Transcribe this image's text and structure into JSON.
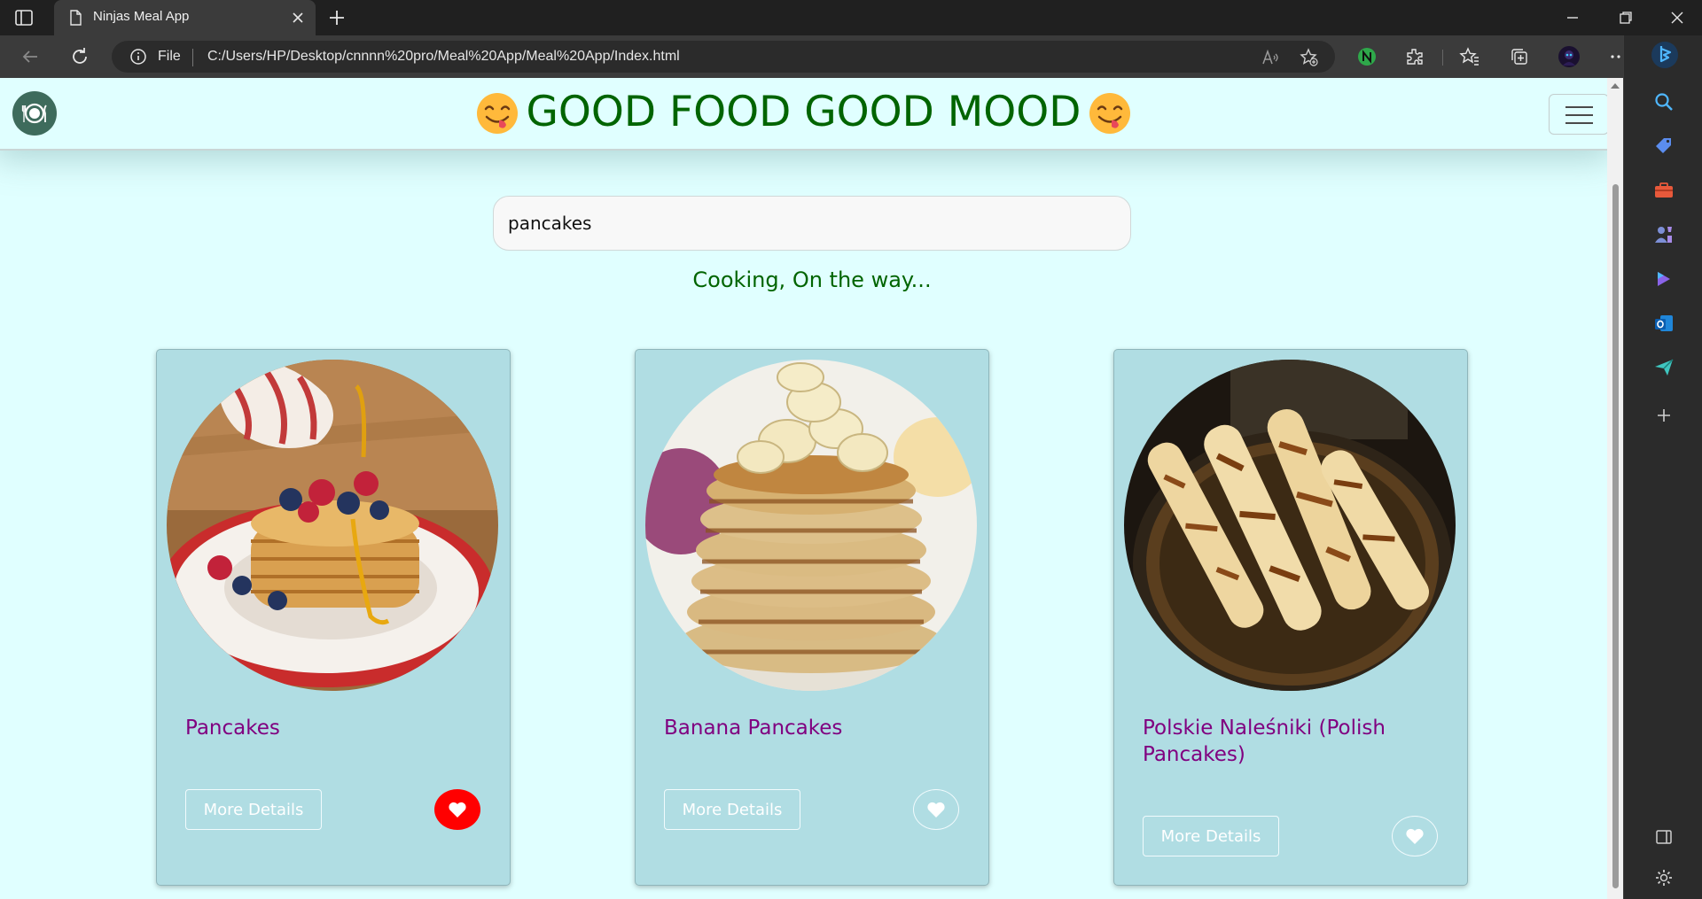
{
  "browser": {
    "tab_title": "Ninjas Meal App",
    "scheme_label": "File",
    "url": "C:/Users/HP/Desktop/cnnnn%20pro/Meal%20App/Meal%20App/Index.html"
  },
  "app": {
    "title": "GOOD FOOD GOOD MOOD",
    "search": {
      "value": "pancakes",
      "placeholder": ""
    },
    "status": "Cooking, On the way..."
  },
  "meals": [
    {
      "name": "Pancakes",
      "button_label": "More Details",
      "favorite": true
    },
    {
      "name": "Banana Pancakes",
      "button_label": "More Details",
      "favorite": false
    },
    {
      "name": "Polskie Naleśniki (Polish Pancakes)",
      "button_label": "More Details",
      "favorite": false
    }
  ],
  "colors": {
    "page_bg": "#e0ffff",
    "title": "#006400",
    "meal_name": "#800080",
    "card_bg": "#b0dde3",
    "favorite_active": "#ff0000"
  }
}
